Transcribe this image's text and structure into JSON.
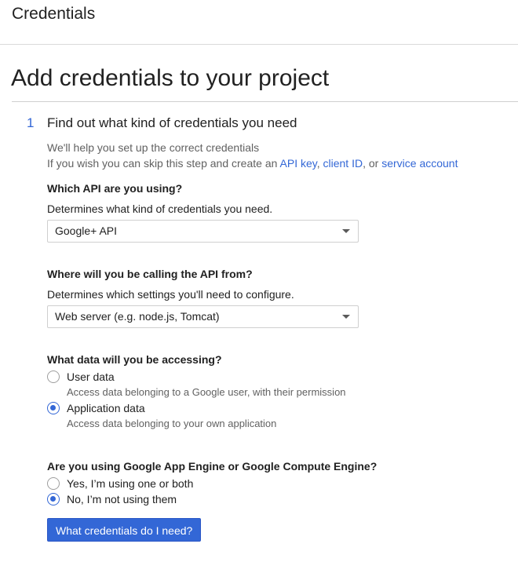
{
  "header": {
    "title": "Credentials"
  },
  "page": {
    "title": "Add credentials to your project"
  },
  "step": {
    "number": "1",
    "title": "Find out what kind of credentials you need",
    "intro_line1": "We'll help you set up the correct credentials",
    "intro_line2_prefix": "If you wish you can skip this step and create an ",
    "link_api_key": "API key",
    "sep1": ", ",
    "link_client_id": "client ID",
    "sep2": ", or ",
    "link_service_account": "service account"
  },
  "q1": {
    "label": "Which API are you using?",
    "desc": "Determines what kind of credentials you need.",
    "selected": "Google+ API"
  },
  "q2": {
    "label": "Where will you be calling the API from?",
    "desc": "Determines which settings you'll need to configure.",
    "selected": "Web server (e.g. node.js, Tomcat)"
  },
  "q3": {
    "label": "What data will you be accessing?",
    "options": [
      {
        "label": "User data",
        "help": "Access data belonging to a Google user, with their permission",
        "checked": false
      },
      {
        "label": "Application data",
        "help": "Access data belonging to your own application",
        "checked": true
      }
    ]
  },
  "q4": {
    "label": "Are you using Google App Engine or Google Compute Engine?",
    "options": [
      {
        "label": "Yes, I’m using one or both",
        "checked": false
      },
      {
        "label": "No, I’m not using them",
        "checked": true
      }
    ]
  },
  "submit": {
    "label": "What credentials do I need?"
  },
  "colors": {
    "accent": "#3367d6",
    "text": "#212121",
    "muted": "#616161",
    "divider": "#dadada"
  },
  "icons": {
    "dropdown": "caret-down-icon",
    "radio_on": "radio-checked-icon",
    "radio_off": "radio-unchecked-icon"
  }
}
